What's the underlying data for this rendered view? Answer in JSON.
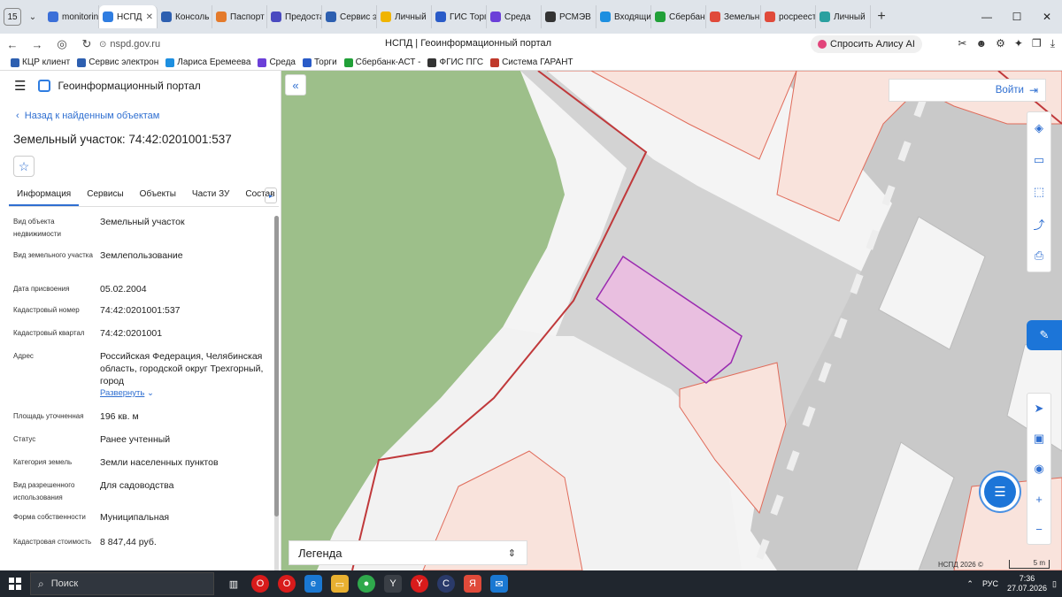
{
  "browser": {
    "tab_count": "15",
    "tabs": [
      {
        "label": "monitoring",
        "color": "#3b6fd8"
      },
      {
        "label": "НСПД",
        "color": "#2f7de1",
        "active": true
      },
      {
        "label": "Консоль",
        "color": "#2d5fb0"
      },
      {
        "label": "Паспорт",
        "color": "#e47a2b"
      },
      {
        "label": "Предоста",
        "color": "#4a4ac0"
      },
      {
        "label": "Сервис э",
        "color": "#2d5fb0"
      },
      {
        "label": "Личный",
        "color": "#f0b400"
      },
      {
        "label": "ГИС Торг",
        "color": "#2a5bc8"
      },
      {
        "label": "Среда",
        "color": "#6b3fd8"
      },
      {
        "label": "РСМЭВ",
        "color": "#333333"
      },
      {
        "label": "Входящи",
        "color": "#1d8fe0"
      },
      {
        "label": "Сбербан",
        "color": "#21a038"
      },
      {
        "label": "Земельн",
        "color": "#e04a3a"
      },
      {
        "label": "росреест",
        "color": "#e04a3a"
      },
      {
        "label": "Личный",
        "color": "#2aa0a0"
      }
    ],
    "url": "nspd.gov.ru",
    "page_title": "НСПД | Геоинформационный портал",
    "alisa_label": "Спросить Алису AI",
    "bookmarks": [
      {
        "label": "КЦР клиент",
        "color": "#2d5fb0"
      },
      {
        "label": "Сервис электрон",
        "color": "#2d5fb0"
      },
      {
        "label": "Лариса Еремеева",
        "color": "#1d8fe0"
      },
      {
        "label": "Среда",
        "color": "#6b3fd8"
      },
      {
        "label": "Торги",
        "color": "#2a5bc8"
      },
      {
        "label": "Сбербанк-АСТ -",
        "color": "#21a038"
      },
      {
        "label": "ФГИС ПГС",
        "color": "#333333"
      },
      {
        "label": "Система ГАРАНТ",
        "color": "#c0392b"
      }
    ]
  },
  "panel": {
    "portal_title": "Геоинформационный портал",
    "back_link": "Назад к найденным объектам",
    "object_title": "Земельный участок: 74:42:0201001:537",
    "tabs": [
      "Информация",
      "Сервисы",
      "Объекты",
      "Части ЗУ",
      "Состав"
    ],
    "properties": [
      {
        "key": "Вид объекта недвижимости",
        "value": "Земельный участок"
      },
      {
        "key": "Вид земельного участка",
        "value": "Землепользование"
      },
      {
        "key": "Дата присвоения",
        "value": "05.02.2004"
      },
      {
        "key": "Кадастровый номер",
        "value": "74:42:0201001:537"
      },
      {
        "key": "Кадастровый квартал",
        "value": "74:42:0201001"
      },
      {
        "key": "Адрес",
        "value": "Российская Федерация, Челябинская область, городской округ Трехгорный, город"
      },
      {
        "key": "Площадь уточненная",
        "value": "196 кв. м"
      },
      {
        "key": "Статус",
        "value": "Ранее учтенный"
      },
      {
        "key": "Категория земель",
        "value": "Земли населенных пунктов"
      },
      {
        "key": "Вид разрешенного использования",
        "value": "Для садоводства"
      },
      {
        "key": "Форма собственности",
        "value": "Муниципальная"
      },
      {
        "key": "Кадастровая стоимость",
        "value": "8 847,44 руб."
      }
    ],
    "expand_label": "Развернуть"
  },
  "map": {
    "login_label": "Войти",
    "legend_label": "Легенда",
    "attribution": "НСПД 2026 ©",
    "scale_label": "5 m",
    "colors": {
      "parcel_selected": "#e9bfe0",
      "parcel_border": "#9b2bb0",
      "boundary": "#c0393b",
      "forest": "#9dbf8a"
    }
  },
  "taskbar": {
    "search_label": "Поиск",
    "lang": "РУС",
    "time": "7:36",
    "date": "27.07.2026"
  }
}
